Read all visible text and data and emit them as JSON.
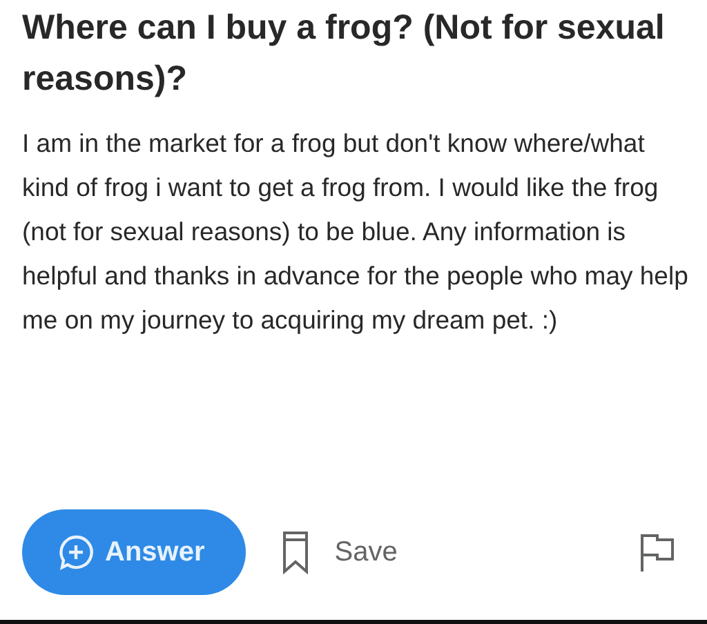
{
  "question": {
    "title": "Where can I buy a frog? (Not for sexual reasons)?",
    "details": "I am in the market for a frog but don't know where/what kind of frog i want to get a frog from. I would like the frog (not for sexual reasons) to be blue. Any information is helpful and thanks in advance for the people who may help me on my journey to acquiring my dream pet. :)"
  },
  "actions": {
    "answer": "Answer",
    "save": "Save"
  }
}
